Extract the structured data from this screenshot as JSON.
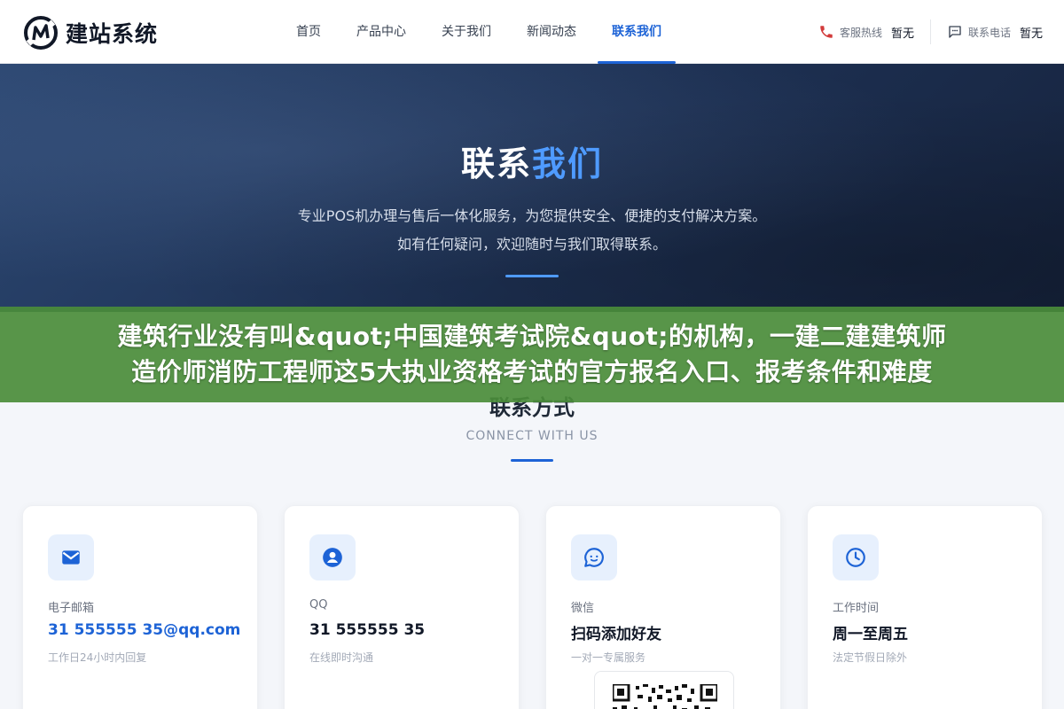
{
  "header": {
    "logo_text": "建站系统",
    "nav": [
      {
        "label": "首页"
      },
      {
        "label": "产品中心"
      },
      {
        "label": "关于我们"
      },
      {
        "label": "新闻动态"
      },
      {
        "label": "联系我们",
        "active": true
      }
    ],
    "hotlines": [
      {
        "label": "客服热线",
        "value": "暂无",
        "icon": "phone-icon"
      },
      {
        "label": "联系电话",
        "value": "暂无",
        "icon": "chat-icon"
      }
    ]
  },
  "hero": {
    "title_main": "联系",
    "title_accent": "我们",
    "line1": "专业POS机办理与售后一体化服务，为您提供安全、便捷的支付解决方案。",
    "line2": "如有任何疑问，欢迎随时与我们取得联系。"
  },
  "banner": {
    "line1": "建筑行业没有叫&quot;中国建筑考试院&quot;的机构，一建二建建筑师",
    "line2": "造价师消防工程师这5大执业资格考试的官方报名入口、报考条件和难度"
  },
  "section": {
    "title": "联系方式",
    "subtitle": "CONNECT WITH US"
  },
  "cards": [
    {
      "icon": "mail-icon",
      "label": "电子邮箱",
      "value": "31 555555 35@qq.com",
      "note": "工作日24小时内回复"
    },
    {
      "icon": "user-icon",
      "label": "QQ",
      "value": "31 555555 35",
      "note": "在线即时沟通"
    },
    {
      "icon": "wechat-icon",
      "label": "微信",
      "value": "扫码添加好友",
      "note": "一对一专属服务"
    },
    {
      "icon": "clock-icon",
      "label": "工作时间",
      "value": "周一至周五",
      "note": "法定节假日除外"
    }
  ],
  "colors": {
    "accent": "#1d63d6",
    "hero_accent": "#4f9bff",
    "banner": "#4a8c3a",
    "hero_bg": "#1d3052"
  }
}
